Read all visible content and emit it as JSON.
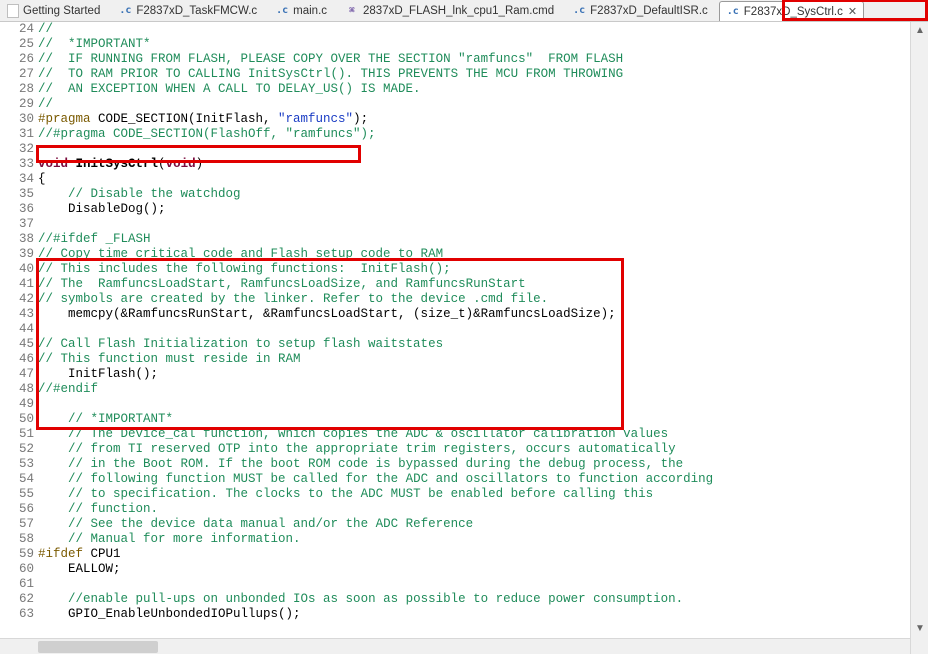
{
  "tabs": [
    {
      "icon": "page",
      "label": "Getting Started"
    },
    {
      "icon": "c",
      "label": "F2837xD_TaskFMCW.c"
    },
    {
      "icon": "c",
      "label": "main.c"
    },
    {
      "icon": "cmd",
      "label": "2837xD_FLASH_lnk_cpu1_Ram.cmd"
    },
    {
      "icon": "c",
      "label": "F2837xD_DefaultISR.c"
    },
    {
      "icon": "c",
      "label": "F2837xD_SysCtrl.c",
      "active": true,
      "closable": true
    }
  ],
  "first_line_no": 24,
  "code": [
    [
      {
        "cls": "c-comment",
        "t": "//"
      }
    ],
    [
      {
        "cls": "c-comment",
        "t": "//  *IMPORTANT*"
      }
    ],
    [
      {
        "cls": "c-comment",
        "t": "//  IF RUNNING FROM FLASH, PLEASE COPY OVER THE SECTION \"ramfuncs\"  FROM FLASH"
      }
    ],
    [
      {
        "cls": "c-comment",
        "t": "//  TO RAM PRIOR TO CALLING InitSysCtrl(). THIS PREVENTS THE MCU FROM THROWING"
      }
    ],
    [
      {
        "cls": "c-comment",
        "t": "//  AN EXCEPTION WHEN A CALL TO DELAY_US() IS MADE."
      }
    ],
    [
      {
        "cls": "c-comment",
        "t": "//"
      }
    ],
    [
      {
        "cls": "c-pre",
        "t": "#pragma"
      },
      {
        "t": " CODE_SECTION(InitFlash, "
      },
      {
        "cls": "c-string",
        "t": "\"ramfuncs\""
      },
      {
        "t": ");"
      }
    ],
    [
      {
        "cls": "c-comment",
        "t": "//#pragma CODE_SECTION(FlashOff, \"ramfuncs\");"
      }
    ],
    [],
    [
      {
        "cls": "c-keyword",
        "t": "void"
      },
      {
        "t": " "
      },
      {
        "cls": "c-func",
        "t": "InitSysCtrl"
      },
      {
        "t": "("
      },
      {
        "cls": "c-keyword",
        "t": "void"
      },
      {
        "t": ")"
      }
    ],
    [
      {
        "t": "{"
      }
    ],
    [
      {
        "t": "    "
      },
      {
        "cls": "c-comment",
        "t": "// Disable the watchdog"
      }
    ],
    [
      {
        "t": "    DisableDog();"
      }
    ],
    [],
    [
      {
        "cls": "c-comment",
        "t": "//#ifdef _FLASH"
      }
    ],
    [
      {
        "cls": "c-comment",
        "t": "// Copy time critical code and Flash setup code to RAM"
      }
    ],
    [
      {
        "cls": "c-comment",
        "t": "// This includes the following functions:  InitFlash();"
      }
    ],
    [
      {
        "cls": "c-comment",
        "t": "// The  RamfuncsLoadStart, RamfuncsLoadSize, and RamfuncsRunStart"
      }
    ],
    [
      {
        "cls": "c-comment",
        "t": "// symbols are created by the linker. Refer to the device .cmd file."
      }
    ],
    [
      {
        "t": "    memcpy(&RamfuncsRunStart, &RamfuncsLoadStart, (size_t)&RamfuncsLoadSize);"
      }
    ],
    [],
    [
      {
        "cls": "c-comment",
        "t": "// Call Flash Initialization to setup flash waitstates"
      }
    ],
    [
      {
        "cls": "c-comment",
        "t": "// This function must reside in RAM"
      }
    ],
    [
      {
        "t": "    InitFlash();"
      }
    ],
    [
      {
        "cls": "c-comment",
        "t": "//#endif"
      }
    ],
    [],
    [
      {
        "t": "    "
      },
      {
        "cls": "c-comment",
        "t": "// *IMPORTANT*"
      }
    ],
    [
      {
        "t": "    "
      },
      {
        "cls": "c-comment",
        "t": "// The Device_cal function, which copies the ADC & oscillator calibration values"
      }
    ],
    [
      {
        "t": "    "
      },
      {
        "cls": "c-comment",
        "t": "// from TI reserved OTP into the appropriate trim registers, occurs automatically"
      }
    ],
    [
      {
        "t": "    "
      },
      {
        "cls": "c-comment",
        "t": "// in the Boot ROM. If the boot ROM code is bypassed during the debug process, the"
      }
    ],
    [
      {
        "t": "    "
      },
      {
        "cls": "c-comment",
        "t": "// following function MUST be called for the ADC and oscillators to function according"
      }
    ],
    [
      {
        "t": "    "
      },
      {
        "cls": "c-comment",
        "t": "// to specification. The clocks to the ADC MUST be enabled before calling this"
      }
    ],
    [
      {
        "t": "    "
      },
      {
        "cls": "c-comment",
        "t": "// function."
      }
    ],
    [
      {
        "t": "    "
      },
      {
        "cls": "c-comment",
        "t": "// See the device data manual and/or the ADC Reference"
      }
    ],
    [
      {
        "t": "    "
      },
      {
        "cls": "c-comment",
        "t": "// Manual for more information."
      }
    ],
    [
      {
        "cls": "c-pre",
        "t": "#ifdef"
      },
      {
        "t": " CPU1"
      }
    ],
    [
      {
        "t": "    EALLOW;"
      }
    ],
    [],
    [
      {
        "t": "    "
      },
      {
        "cls": "c-comment",
        "t": "//enable pull-ups on unbonded IOs as soon as possible to reduce power consumption."
      }
    ],
    [
      {
        "t": "    GPIO_EnableUnbondedIOPullups();"
      }
    ]
  ]
}
